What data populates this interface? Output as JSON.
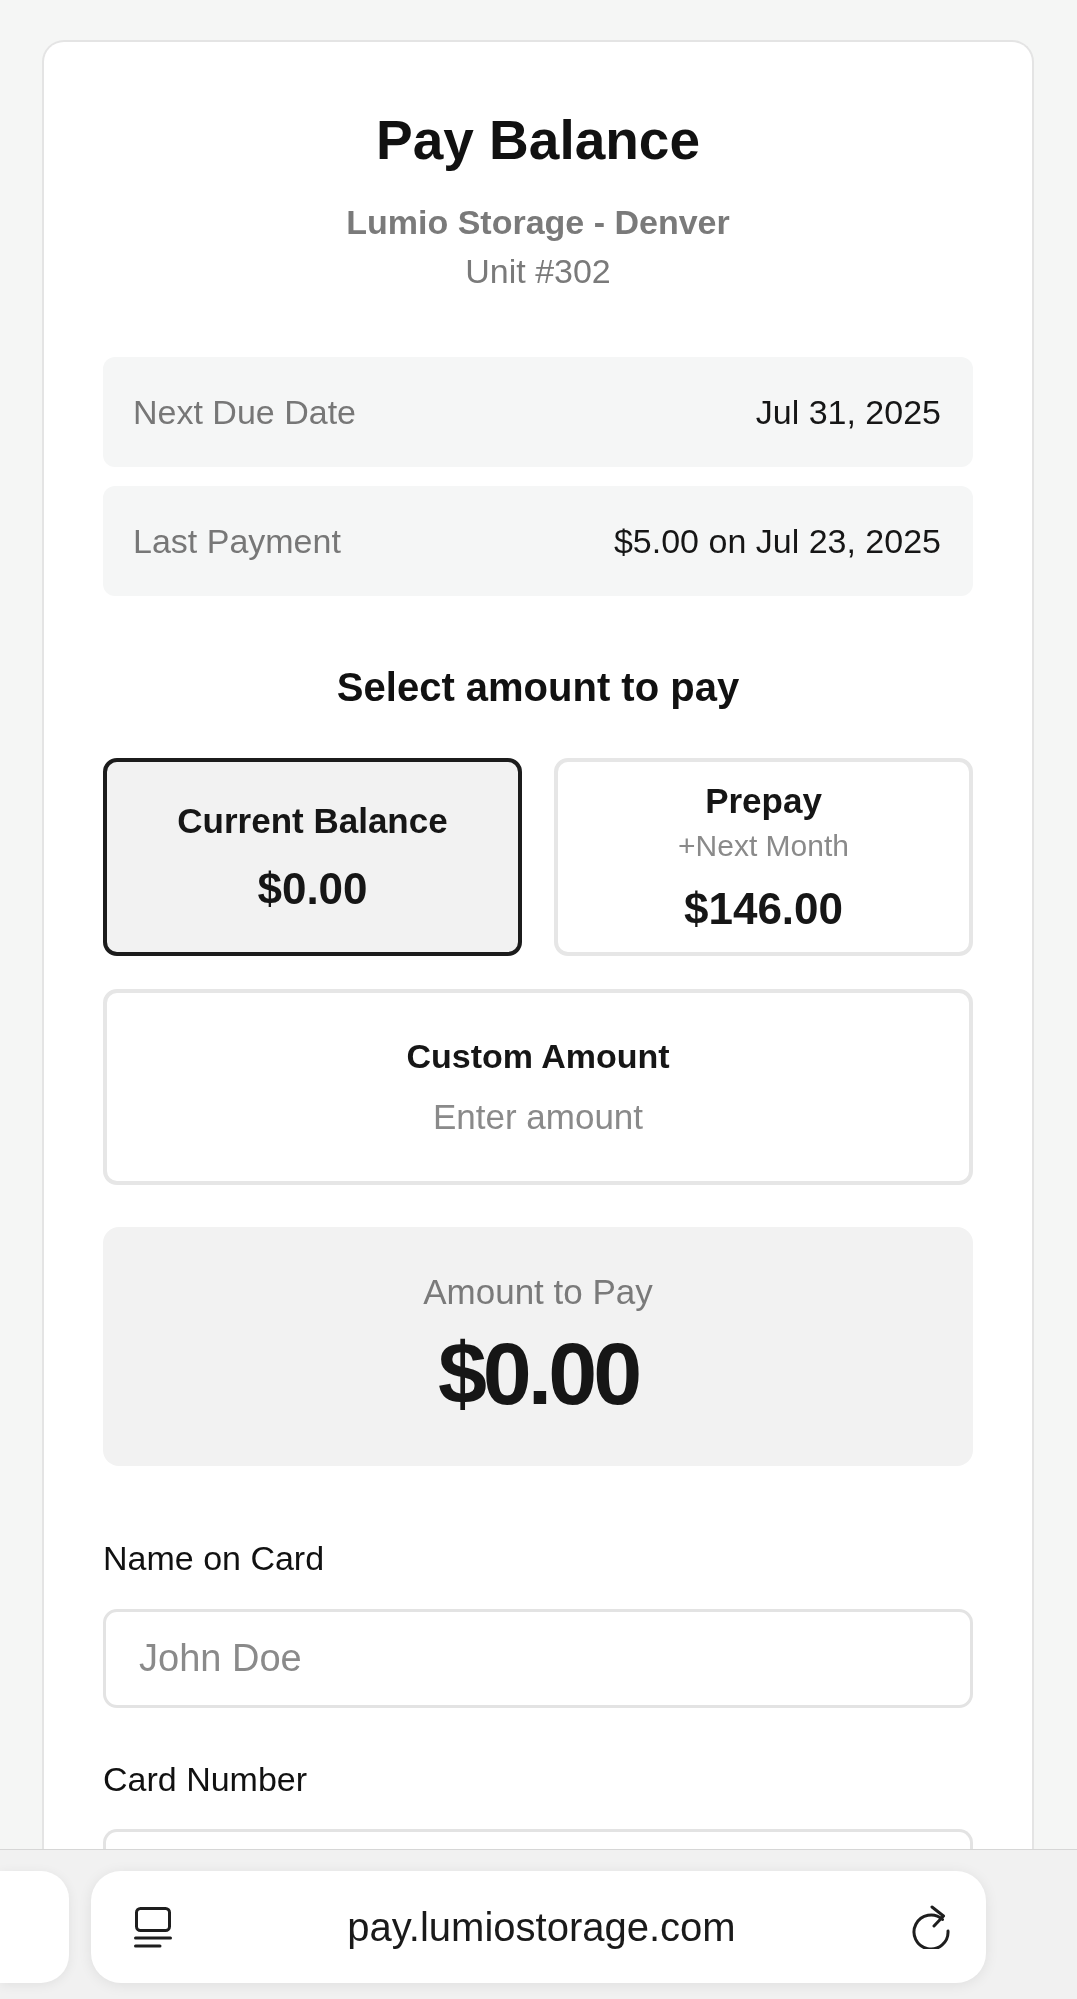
{
  "header": {
    "title": "Pay Balance",
    "facility": "Lumio Storage - Denver",
    "unit": "Unit #302"
  },
  "summary": [
    {
      "label": "Next Due Date",
      "value": "Jul 31, 2025"
    },
    {
      "label": "Last Payment",
      "value": "$5.00 on Jul 23, 2025"
    }
  ],
  "amount_section": {
    "heading": "Select amount to pay",
    "options": [
      {
        "kind": "preset",
        "title": "Current Balance",
        "amount": "$0.00",
        "selected": true
      },
      {
        "kind": "preset",
        "title": "Prepay",
        "note": "+Next Month",
        "amount": "$146.00",
        "selected": false
      },
      {
        "kind": "custom",
        "title": "Custom Amount",
        "placeholder": "Enter amount",
        "selected": false
      }
    ]
  },
  "amount_to_pay": {
    "label": "Amount to Pay",
    "value": "$0.00"
  },
  "form": {
    "fields": [
      {
        "label": "Name on Card",
        "placeholder": "John Doe"
      },
      {
        "label": "Card Number"
      }
    ]
  },
  "browser_bar": {
    "url": "pay.lumiostorage.com"
  }
}
